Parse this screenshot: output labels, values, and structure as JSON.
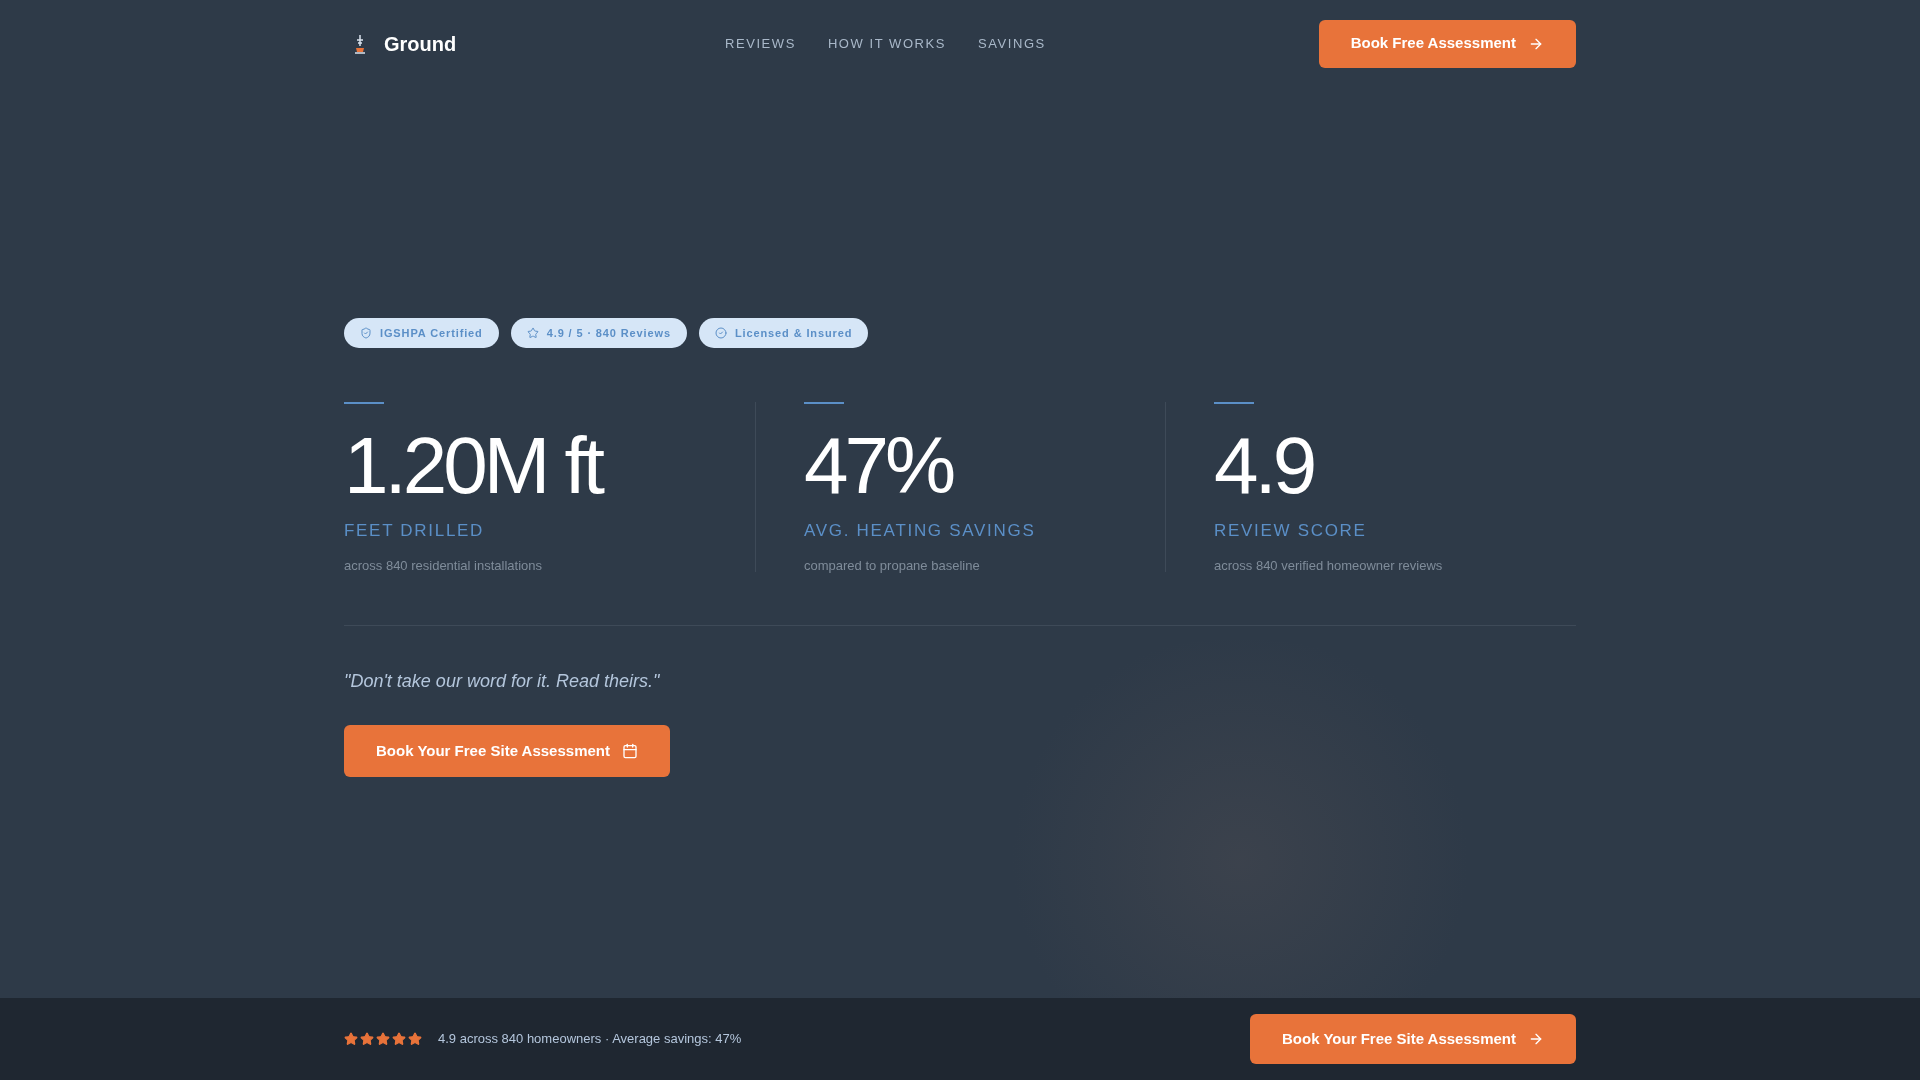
{
  "header": {
    "brand": "Ground",
    "nav": [
      "REVIEWS",
      "HOW IT WORKS",
      "SAVINGS"
    ],
    "cta": "Book Free Assessment"
  },
  "badges": [
    {
      "kind": "shield",
      "label": "IGSHPA Certified"
    },
    {
      "kind": "star",
      "label": "4.9 / 5 · 840 Reviews"
    },
    {
      "kind": "check",
      "label": "Licensed & Insured"
    }
  ],
  "stats": [
    {
      "value": "1.20M ft",
      "label": "FEET DRILLED",
      "note": "across 840 residential installations"
    },
    {
      "value": "47%",
      "label": "AVG. HEATING SAVINGS",
      "note": "compared to propane baseline"
    },
    {
      "value": "4.9",
      "label": "REVIEW SCORE",
      "note": "across 840 verified homeowner reviews"
    }
  ],
  "quote": "\"Don't take our word for it. Read theirs.\"",
  "cta": "Book Your Free Site Assessment",
  "footer_bar": {
    "stars": 5,
    "summary": "4.9 across 840 homeowners · Average savings: 47%",
    "cta": "Book Your Free Site Assessment"
  }
}
